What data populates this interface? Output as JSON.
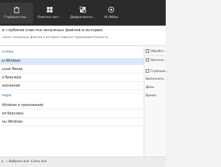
{
  "toolbar": {
    "items": [
      {
        "label": "Глубокая очи…",
        "icon": "trash-icon"
      },
      {
        "label": "Очистка сист…",
        "icon": "windows-icon"
      },
      {
        "label": "Дефрагмента…",
        "icon": "defrag-icon"
      },
      {
        "label": "AI UltBox",
        "icon": "ai-icon"
      }
    ]
  },
  "header": {
    "title": "и глубокая очистка ненужных файлов и истории.",
    "subtitle": "ление ненужных файлов и истории повысит производительность."
  },
  "sections": [
    {
      "title": "нтера",
      "items": [
        "ы Windows",
        "ьные Мessи",
        "а браузера",
        "иложений"
      ]
    },
    {
      "title": "нера",
      "items": [
        "Windows и приложений",
        "ия браузера",
        "пы Windows"
      ]
    }
  ],
  "right_panel": {
    "items": [
      {
        "label": "Обработ…",
        "has_checkbox": true
      },
      {
        "label": "Автоочи…",
        "has_checkbox": true
      },
      {
        "label": "Глубокая…",
        "has_checkbox": true
      },
      {
        "label": "Выполнить:",
        "has_checkbox": false
      },
      {
        "label": "День:",
        "has_checkbox": false
      },
      {
        "label": "Время:",
        "has_checkbox": false
      }
    ]
  },
  "bottom": {
    "select_all": "Выбрать всё",
    "deselect_all": "Снять всё",
    "prefix": "а"
  },
  "colors": {
    "toolbar": "#2b2b2b",
    "accent": "#1d72c9",
    "selected": "#d9e8f7"
  }
}
